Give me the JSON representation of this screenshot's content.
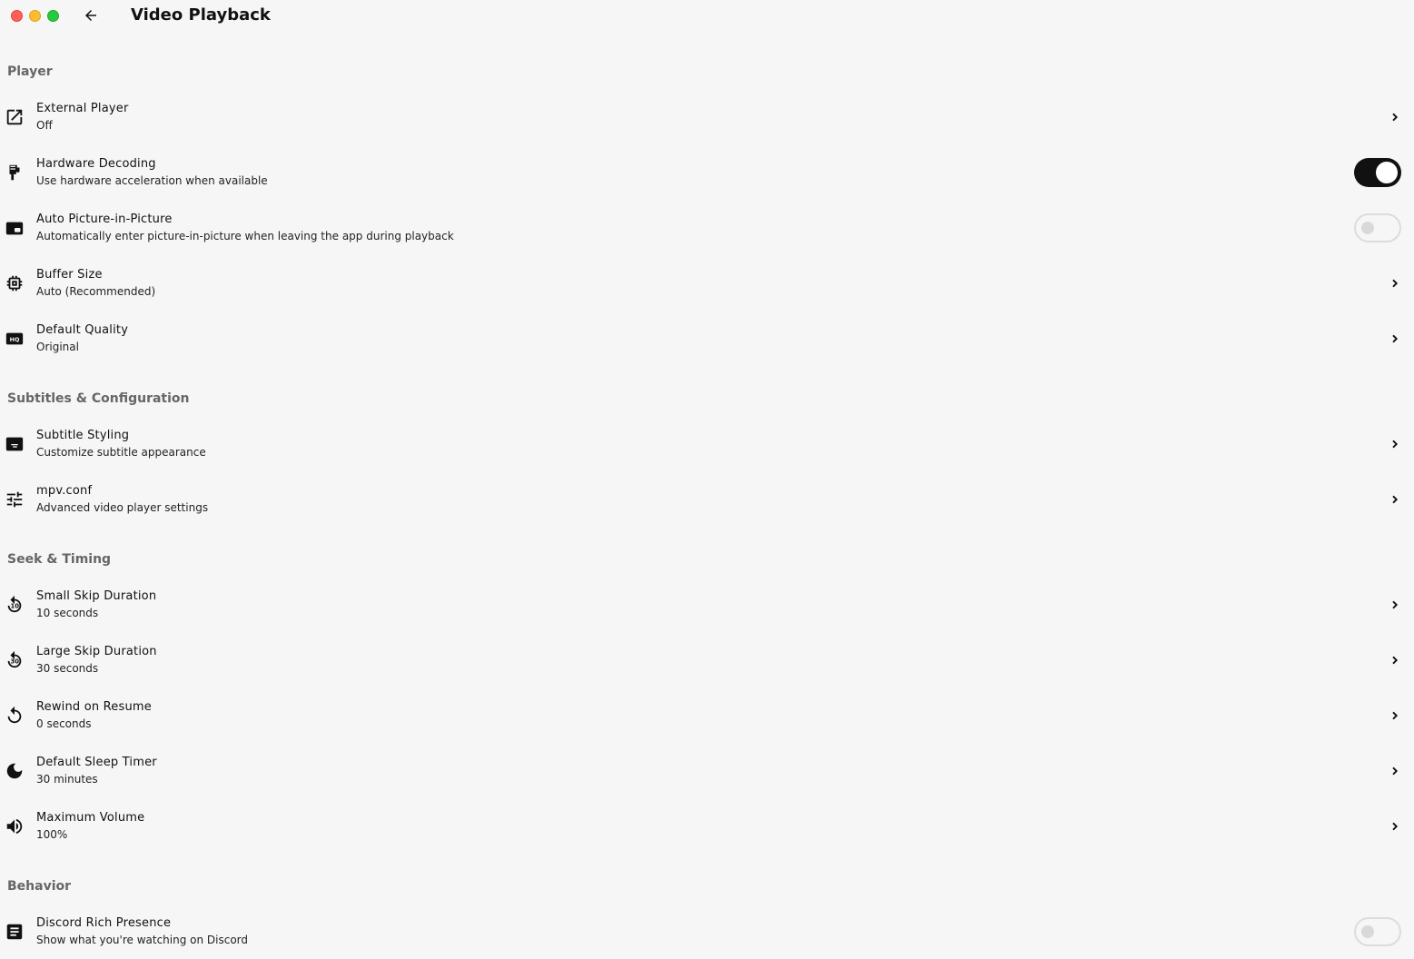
{
  "window": {
    "title": "Video Playback"
  },
  "colors": {
    "background": "#f6f6f6",
    "toggle_on": "#111111",
    "section_header": "#666666"
  },
  "sections": [
    {
      "header": "Player",
      "items": [
        {
          "title": "External Player",
          "subtitle": "Off",
          "icon": "open-external-icon",
          "control": "chevron"
        },
        {
          "title": "Hardware Decoding",
          "subtitle": "Use hardware acceleration when available",
          "icon": "hardware-icon",
          "control": "toggle",
          "enabled": true
        },
        {
          "title": "Auto Picture-in-Picture",
          "subtitle": "Automatically enter picture-in-picture when leaving the app during playback",
          "icon": "picture-in-picture-icon",
          "control": "toggle",
          "enabled": false
        },
        {
          "title": "Buffer Size",
          "subtitle": "Auto (Recommended)",
          "icon": "memory-chip-icon",
          "control": "chevron"
        },
        {
          "title": "Default Quality",
          "subtitle": "Original",
          "icon": "hq-icon",
          "control": "chevron"
        }
      ]
    },
    {
      "header": "Subtitles & Configuration",
      "items": [
        {
          "title": "Subtitle Styling",
          "subtitle": "Customize subtitle appearance",
          "icon": "subtitles-icon",
          "control": "chevron"
        },
        {
          "title": "mpv.conf",
          "subtitle": "Advanced video player settings",
          "icon": "tune-sliders-icon",
          "control": "chevron"
        }
      ]
    },
    {
      "header": "Seek & Timing",
      "items": [
        {
          "title": "Small Skip Duration",
          "subtitle": "10 seconds",
          "icon": "replay-10-icon",
          "icon_text": "10",
          "control": "chevron"
        },
        {
          "title": "Large Skip Duration",
          "subtitle": "30 seconds",
          "icon": "replay-30-icon",
          "icon_text": "30",
          "control": "chevron"
        },
        {
          "title": "Rewind on Resume",
          "subtitle": "0 seconds",
          "icon": "replay-icon",
          "control": "chevron"
        },
        {
          "title": "Default Sleep Timer",
          "subtitle": "30 minutes",
          "icon": "moon-icon",
          "control": "chevron"
        },
        {
          "title": "Maximum Volume",
          "subtitle": "100%",
          "icon": "volume-icon",
          "control": "chevron"
        }
      ]
    },
    {
      "header": "Behavior",
      "items": [
        {
          "title": "Discord Rich Presence",
          "subtitle": "Show what you're watching on Discord",
          "icon": "notes-icon",
          "control": "toggle",
          "enabled": false
        }
      ]
    }
  ]
}
